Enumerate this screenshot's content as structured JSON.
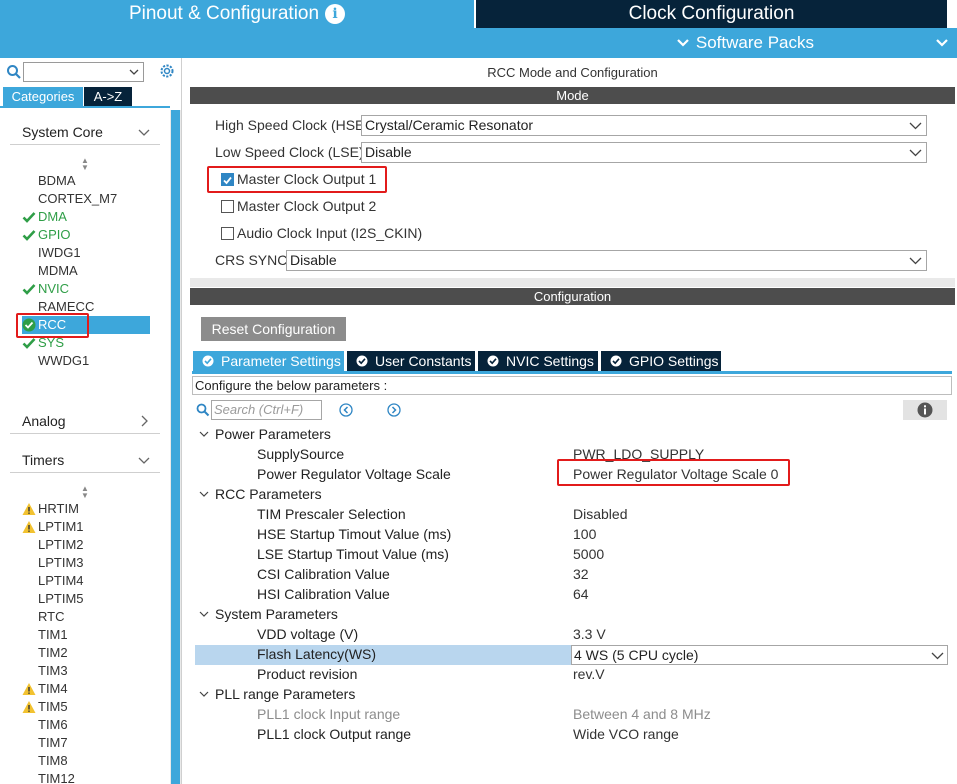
{
  "tabs": {
    "pinout_label": "Pinout & Configuration",
    "clock_label": "Clock Configuration",
    "software_packs_label": "Software Packs"
  },
  "sidebar": {
    "tabs": [
      "Categories",
      "A->Z"
    ],
    "sections": [
      {
        "title": "System Core",
        "expanded": true
      },
      {
        "title": "Analog",
        "expanded": false
      },
      {
        "title": "Timers",
        "expanded": true
      }
    ],
    "system_core_items": [
      {
        "label": "BDMA",
        "status": ""
      },
      {
        "label": "CORTEX_M7",
        "status": ""
      },
      {
        "label": "DMA",
        "status": "ok"
      },
      {
        "label": "GPIO",
        "status": "ok"
      },
      {
        "label": "IWDG1",
        "status": ""
      },
      {
        "label": "MDMA",
        "status": ""
      },
      {
        "label": "NVIC",
        "status": "ok"
      },
      {
        "label": "RAMECC",
        "status": ""
      },
      {
        "label": "RCC",
        "status": "selected"
      },
      {
        "label": "SYS",
        "status": "ok"
      },
      {
        "label": "WWDG1",
        "status": ""
      }
    ],
    "timer_items": [
      {
        "label": "HRTIM",
        "status": "warn"
      },
      {
        "label": "LPTIM1",
        "status": "warn"
      },
      {
        "label": "LPTIM2",
        "status": ""
      },
      {
        "label": "LPTIM3",
        "status": ""
      },
      {
        "label": "LPTIM4",
        "status": ""
      },
      {
        "label": "LPTIM5",
        "status": ""
      },
      {
        "label": "RTC",
        "status": ""
      },
      {
        "label": "TIM1",
        "status": ""
      },
      {
        "label": "TIM2",
        "status": ""
      },
      {
        "label": "TIM3",
        "status": ""
      },
      {
        "label": "TIM4",
        "status": "warn"
      },
      {
        "label": "TIM5",
        "status": "warn"
      },
      {
        "label": "TIM6",
        "status": ""
      },
      {
        "label": "TIM7",
        "status": ""
      },
      {
        "label": "TIM8",
        "status": ""
      },
      {
        "label": "TIM12",
        "status": ""
      }
    ]
  },
  "main": {
    "title": "RCC Mode and Configuration",
    "mode_header": "Mode",
    "hse_label": "High Speed Clock (HSE)",
    "hse_value": "Crystal/Ceramic Resonator",
    "lse_label": "Low Speed Clock (LSE)",
    "lse_value": "Disable",
    "checkboxes": [
      {
        "label": "Master Clock Output 1",
        "checked": true
      },
      {
        "label": "Master Clock Output 2",
        "checked": false
      },
      {
        "label": "Audio Clock Input (I2S_CKIN)",
        "checked": false
      }
    ],
    "crs_label": "CRS SYNC",
    "crs_value": "Disable",
    "config_header": "Configuration",
    "reset_button": "Reset Configuration",
    "config_tabs": [
      "Parameter Settings",
      "User Constants",
      "NVIC Settings",
      "GPIO Settings"
    ],
    "configure_text": "Configure the below parameters :",
    "search_placeholder": "Search (Ctrl+F)"
  },
  "params": {
    "power_group": "Power Parameters",
    "supply_source": {
      "name": "SupplySource",
      "value": "PWR_LDO_SUPPLY"
    },
    "voltage_scale": {
      "name": "Power Regulator Voltage Scale",
      "value": "Power Regulator Voltage Scale 0"
    },
    "rcc_group": "RCC Parameters",
    "rcc_items": [
      {
        "name": "TIM Prescaler Selection",
        "value": "Disabled"
      },
      {
        "name": "HSE Startup Timout Value (ms)",
        "value": "100"
      },
      {
        "name": "LSE Startup Timout Value (ms)",
        "value": "5000"
      },
      {
        "name": "CSI Calibration Value",
        "value": "32"
      },
      {
        "name": "HSI Calibration Value",
        "value": "64"
      }
    ],
    "system_group": "System Parameters",
    "vdd": {
      "name": "VDD voltage (V)",
      "value": "3.3 V"
    },
    "flash": {
      "name": "Flash Latency(WS)",
      "value": "4 WS (5 CPU cycle)"
    },
    "revision": {
      "name": "Product revision",
      "value": "rev.V"
    },
    "pll_group": "PLL range Parameters",
    "pll_input": {
      "name": "PLL1 clock Input range",
      "value": "Between 4 and 8 MHz"
    },
    "pll_output": {
      "name": "PLL1 clock Output range",
      "value": "Wide VCO range"
    }
  },
  "colors": {
    "accent": "#3da7db",
    "dark_navy": "#06233a",
    "ok_green": "#2f9e47",
    "warn_yellow": "#f2c230",
    "highlight_red": "#e21b1b"
  }
}
